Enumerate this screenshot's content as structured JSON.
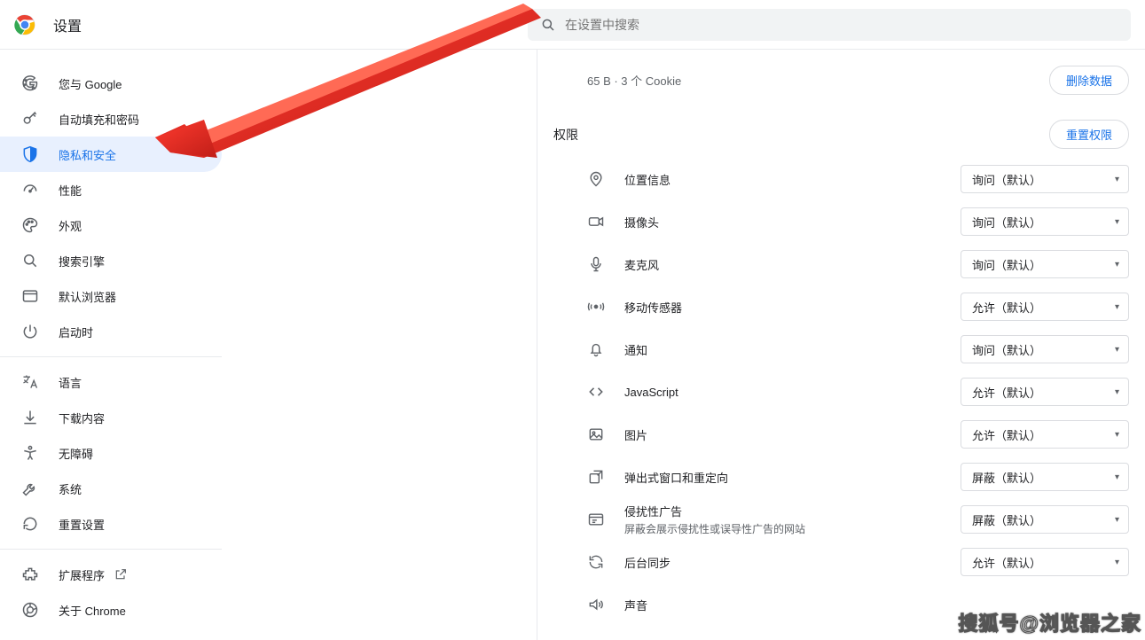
{
  "header": {
    "title": "设置",
    "search_placeholder": "在设置中搜索"
  },
  "sidebar": {
    "groups": [
      {
        "items": [
          {
            "id": "you-google",
            "label": "您与 Google",
            "icon": "google"
          },
          {
            "id": "autofill",
            "label": "自动填充和密码",
            "icon": "key"
          },
          {
            "id": "privacy",
            "label": "隐私和安全",
            "icon": "shield",
            "selected": true
          },
          {
            "id": "performance",
            "label": "性能",
            "icon": "speed"
          },
          {
            "id": "appearance",
            "label": "外观",
            "icon": "palette"
          },
          {
            "id": "search-engine",
            "label": "搜索引擎",
            "icon": "search"
          },
          {
            "id": "default-browser",
            "label": "默认浏览器",
            "icon": "browser"
          },
          {
            "id": "on-startup",
            "label": "启动时",
            "icon": "power"
          }
        ]
      },
      {
        "items": [
          {
            "id": "languages",
            "label": "语言",
            "icon": "translate"
          },
          {
            "id": "downloads",
            "label": "下载内容",
            "icon": "download"
          },
          {
            "id": "accessibility",
            "label": "无障碍",
            "icon": "accessibility"
          },
          {
            "id": "system",
            "label": "系统",
            "icon": "wrench"
          },
          {
            "id": "reset",
            "label": "重置设置",
            "icon": "reset"
          }
        ]
      },
      {
        "items": [
          {
            "id": "extensions",
            "label": "扩展程序",
            "icon": "extension",
            "external": true
          },
          {
            "id": "about",
            "label": "关于 Chrome",
            "icon": "chrome"
          }
        ]
      }
    ]
  },
  "content": {
    "usage_info": "65 B · 3 个 Cookie",
    "clear_data_btn": "删除数据",
    "permissions_title": "权限",
    "reset_permissions_btn": "重置权限",
    "permissions": [
      {
        "id": "location",
        "label": "位置信息",
        "icon": "pin",
        "value": "询问（默认）"
      },
      {
        "id": "camera",
        "label": "摄像头",
        "icon": "camera",
        "value": "询问（默认）"
      },
      {
        "id": "microphone",
        "label": "麦克风",
        "icon": "mic",
        "value": "询问（默认）"
      },
      {
        "id": "motion",
        "label": "移动传感器",
        "icon": "motion",
        "value": "允许（默认）"
      },
      {
        "id": "notifications",
        "label": "通知",
        "icon": "bell",
        "value": "询问（默认）"
      },
      {
        "id": "javascript",
        "label": "JavaScript",
        "icon": "code",
        "value": "允许（默认）"
      },
      {
        "id": "images",
        "label": "图片",
        "icon": "image",
        "value": "允许（默认）"
      },
      {
        "id": "popups",
        "label": "弹出式窗口和重定向",
        "icon": "popup",
        "value": "屏蔽（默认）"
      },
      {
        "id": "ads",
        "label": "侵扰性广告",
        "sub": "屏蔽会展示侵扰性或误导性广告的网站",
        "icon": "ads",
        "value": "屏蔽（默认）"
      },
      {
        "id": "bgsync",
        "label": "后台同步",
        "icon": "sync",
        "value": "允许（默认）"
      },
      {
        "id": "sound",
        "label": "声音",
        "icon": "sound",
        "value": ""
      }
    ]
  },
  "watermark": "搜狐号@浏览器之家"
}
